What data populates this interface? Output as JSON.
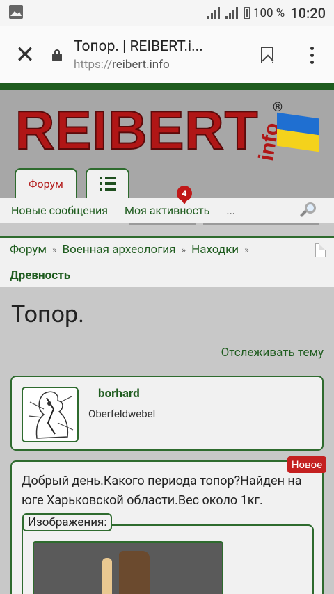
{
  "status": {
    "battery": "100 %",
    "time": "10:20"
  },
  "browser": {
    "title": "Топор. | REIBERT.i...",
    "url_scheme": "https://",
    "url_host": "reibert.info"
  },
  "site": {
    "logo": "REIBERT",
    "logo_suffix": "info",
    "registered": "®"
  },
  "tabs": {
    "forum": "Форум"
  },
  "subnav": {
    "new_messages": "Новые сообщения",
    "my_activity": "Моя активность",
    "more": "...",
    "activity_badge": "4"
  },
  "breadcrumb": {
    "items": [
      "Форум",
      "Военная археология",
      "Находки"
    ],
    "separator": "»",
    "current": "Древность"
  },
  "thread": {
    "title": "Топор.",
    "watch": "Отслеживать тему"
  },
  "user": {
    "name": "borhard",
    "rank": "Oberfeldwebel"
  },
  "post": {
    "badge": "Новое",
    "text": "Добрый день.Какого периода топор?Найден на юге Харьковской области.Вес около 1кг.",
    "images_label": "Изображения:"
  },
  "colors": {
    "accent_green": "#1f5c1f",
    "logo_red": "#b01616",
    "badge_red": "#c42020"
  }
}
